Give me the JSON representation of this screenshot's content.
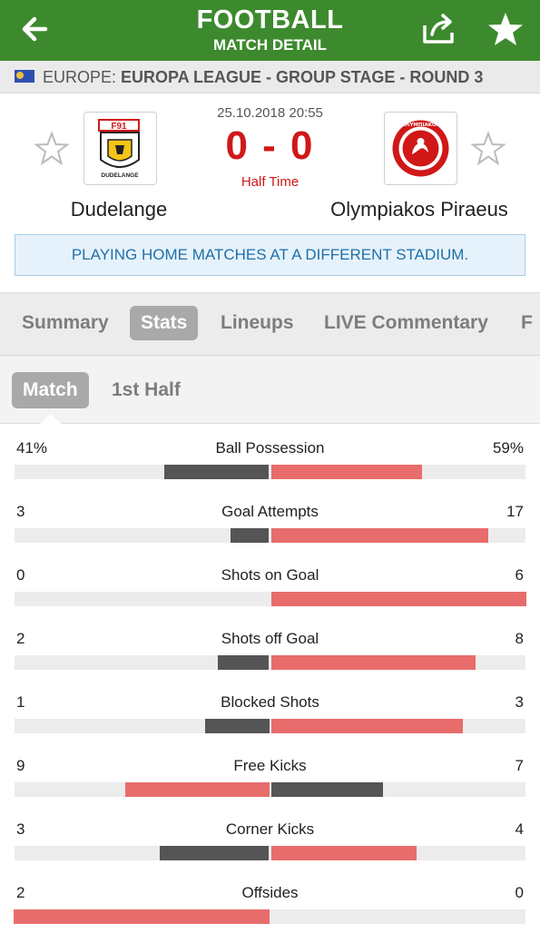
{
  "header": {
    "title": "FOOTBALL",
    "subtitle": "MATCH DETAIL",
    "color": "#3d8a2e"
  },
  "breadcrumb": {
    "region": "EUROPE:",
    "competition": "EUROPA LEAGUE - GROUP STAGE - ROUND 3"
  },
  "match": {
    "datetime": "25.10.2018 20:55",
    "score": "0 - 0",
    "status": "Half Time",
    "home_team": "Dudelange",
    "away_team": "Olympiakos Piraeus",
    "home_logo_text": "DUDELANGE",
    "away_logo_text": "ΟΛΥΜΠΙΑΚΟΣ",
    "notice": "PLAYING HOME MATCHES AT A DIFFERENT STADIUM."
  },
  "tabs": [
    "Summary",
    "Stats",
    "Lineups",
    "LIVE Commentary",
    "F"
  ],
  "active_tab": "Stats",
  "subtabs": [
    "Match",
    "1st Half"
  ],
  "active_subtab": "Match",
  "colors": {
    "home_bar": "#555555",
    "away_bar": "#e86c6c",
    "leader_bar": "#e86c6c",
    "score_red": "#d01818"
  },
  "stats": [
    {
      "label": "Ball Possession",
      "home": "41%",
      "away": "59%",
      "home_value": 41,
      "away_value": 59
    },
    {
      "label": "Goal Attempts",
      "home": "3",
      "away": "17",
      "home_value": 3,
      "away_value": 17
    },
    {
      "label": "Shots on Goal",
      "home": "0",
      "away": "6",
      "home_value": 0,
      "away_value": 6
    },
    {
      "label": "Shots off Goal",
      "home": "2",
      "away": "8",
      "home_value": 2,
      "away_value": 8
    },
    {
      "label": "Blocked Shots",
      "home": "1",
      "away": "3",
      "home_value": 1,
      "away_value": 3
    },
    {
      "label": "Free Kicks",
      "home": "9",
      "away": "7",
      "home_value": 9,
      "away_value": 7
    },
    {
      "label": "Corner Kicks",
      "home": "3",
      "away": "4",
      "home_value": 3,
      "away_value": 4
    },
    {
      "label": "Offsides",
      "home": "2",
      "away": "0",
      "home_value": 2,
      "away_value": 0
    }
  ]
}
